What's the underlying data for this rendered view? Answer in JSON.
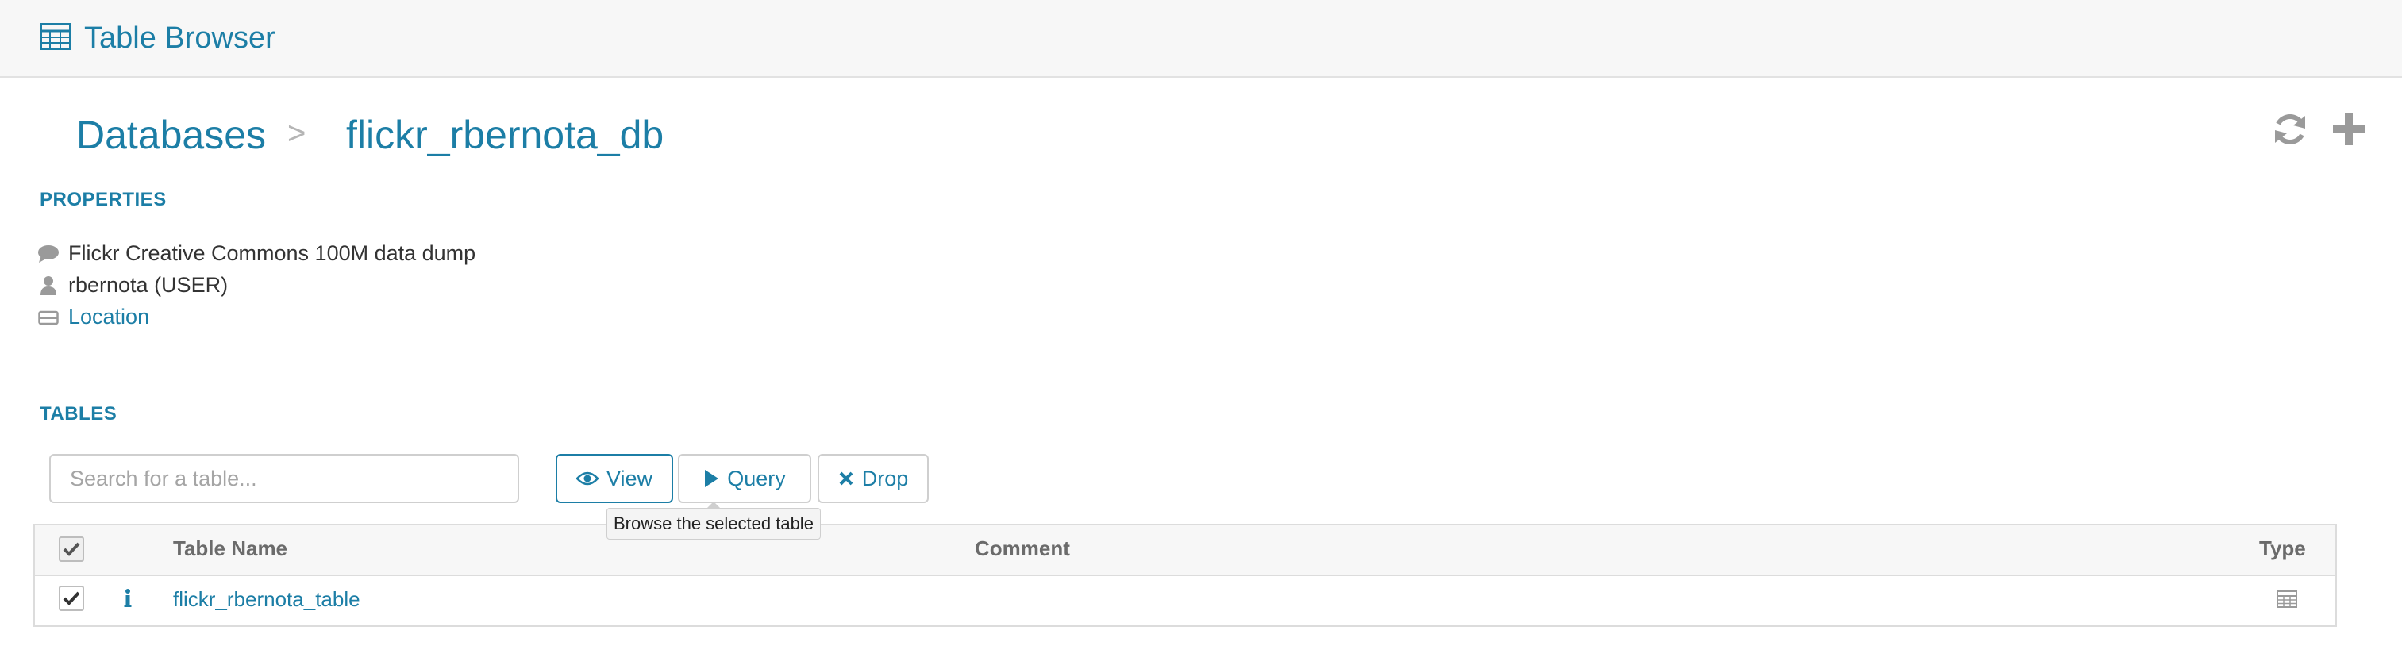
{
  "header": {
    "title": "Table Browser",
    "icon": "table-grid-icon"
  },
  "breadcrumb": {
    "root": "Databases",
    "separator": ">",
    "current": "flickr_rbernota_db"
  },
  "actions": {
    "refresh_icon": "refresh-icon",
    "add_icon": "plus-icon"
  },
  "properties": {
    "title": "PROPERTIES",
    "comment": "Flickr Creative Commons 100M data dump",
    "owner": "rbernota (USER)",
    "location": "Location"
  },
  "tables": {
    "title": "TABLES",
    "search_placeholder": "Search for a table...",
    "buttons": {
      "view": "View",
      "query": "Query",
      "drop": "Drop"
    },
    "tooltip": "Browse the selected table",
    "columns": {
      "name": "Table Name",
      "comment": "Comment",
      "type": "Type"
    },
    "rows": [
      {
        "name": "flickr_rbernota_table",
        "comment": "",
        "checked": true,
        "type_icon": "table-grid-icon"
      }
    ]
  },
  "colors": {
    "accent": "#1c7ea6",
    "muted": "#6b6b6b",
    "border": "#dcdcdc",
    "header_bg": "#f7f7f7"
  }
}
